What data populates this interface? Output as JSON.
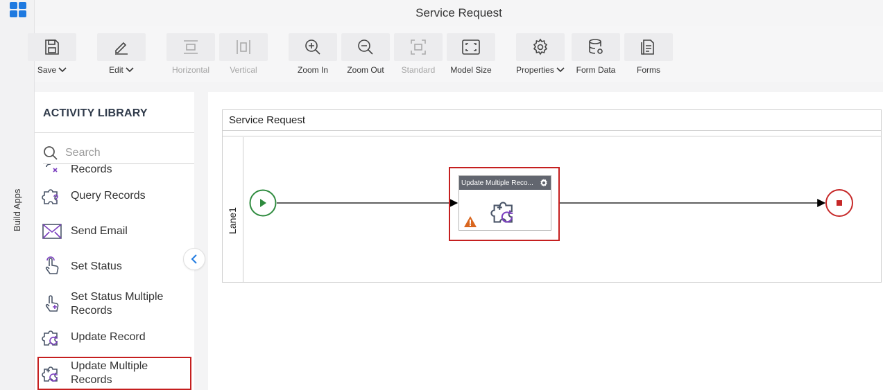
{
  "rail": {
    "label": "Build Apps",
    "icon": "apps-grid-icon",
    "accent": "#1f7ae0"
  },
  "window": {
    "title": "Service Request"
  },
  "toolbar": {
    "save": "Save",
    "edit": "Edit",
    "horizontal": "Horizontal",
    "vertical": "Vertical",
    "zoom_in": "Zoom In",
    "zoom_out": "Zoom Out",
    "standard": "Standard",
    "model_size": "Model Size",
    "properties": "Properties",
    "form_data": "Form Data",
    "forms": "Forms"
  },
  "library": {
    "title": "ACTIVITY LIBRARY",
    "search_placeholder": "Search",
    "items": [
      {
        "label": "Records",
        "icon": "delete-records-icon"
      },
      {
        "label": "Query Records",
        "icon": "query-records-icon"
      },
      {
        "label": "Send Email",
        "icon": "send-email-icon"
      },
      {
        "label": "Set Status",
        "icon": "set-status-icon"
      },
      {
        "label": "Set Status Multiple Records",
        "icon": "set-status-multiple-icon"
      },
      {
        "label": "Update Record",
        "icon": "update-record-icon"
      },
      {
        "label": "Update Multiple Records",
        "icon": "update-multiple-records-icon",
        "selected": true
      }
    ]
  },
  "canvas": {
    "pool_title": "Service Request",
    "lane_label": "Lane1",
    "task_title": "Update Multiple Reco...",
    "start_color": "#2e8b3e",
    "end_color": "#c62828",
    "highlight_color": "#c51f1f"
  }
}
